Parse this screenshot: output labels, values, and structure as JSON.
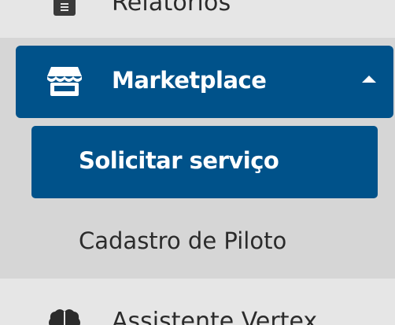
{
  "sidebar": {
    "items_above": [
      {
        "label": "Relatórios",
        "icon": "document-icon"
      }
    ],
    "marketplace": {
      "label": "Marketplace",
      "icon": "store-icon",
      "expanded": true,
      "children": [
        {
          "label": "Solicitar serviço",
          "active": true
        },
        {
          "label": "Cadastro de Piloto",
          "active": false
        }
      ]
    },
    "items_below": [
      {
        "label": "Assistente Vertex",
        "icon": "brain-icon"
      }
    ]
  },
  "colors": {
    "active_bg": "#00528a",
    "group_bg": "#d6d6d6",
    "sidebar_bg": "#e6e6e6",
    "text": "#2b2b2b",
    "active_text": "#ffffff"
  }
}
